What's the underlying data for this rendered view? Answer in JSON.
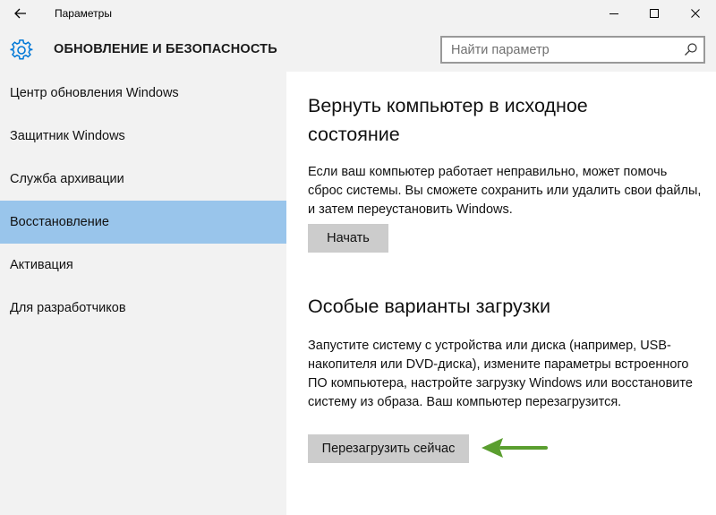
{
  "window": {
    "title": "Параметры"
  },
  "header": {
    "section_title": "ОБНОВЛЕНИЕ И БЕЗОПАСНОСТЬ",
    "search_placeholder": "Найти параметр",
    "search_value": ""
  },
  "sidebar": {
    "items": [
      {
        "label": "Центр обновления Windows",
        "active": false
      },
      {
        "label": "Защитник Windows",
        "active": false
      },
      {
        "label": "Служба архивации",
        "active": false
      },
      {
        "label": "Восстановление",
        "active": true
      },
      {
        "label": "Активация",
        "active": false
      },
      {
        "label": "Для разработчиков",
        "active": false
      }
    ]
  },
  "reset": {
    "title_line1": "Вернуть компьютер в исходное",
    "title_line2": "состояние",
    "description": "Если ваш компьютер работает неправильно, может помочь сброс системы. Вы сможете сохранить или удалить свои файлы, и затем переустановить Windows.",
    "button_label": "Начать"
  },
  "advanced": {
    "title": "Особые варианты загрузки",
    "description": "Запустите систему с устройства или диска (например, USB-накопителя или DVD-диска), измените параметры встроенного ПО компьютера, настройте загрузку Windows или восстановите систему из образа. Ваш компьютер перезагрузится.",
    "button_label": "Перезагрузить сейчас"
  },
  "colors": {
    "chrome_bg": "#f2f2f2",
    "active_item": "#99c5eb",
    "accent": "#0078d7",
    "button_bg": "#cccccc",
    "annotation_arrow": "#5a9e2f"
  },
  "icons": {
    "back": "arrow-left-icon",
    "settings": "gear-icon",
    "search": "search-icon",
    "minimize": "minimize-icon",
    "maximize": "maximize-icon",
    "close": "close-icon",
    "annotation": "arrow-left-annotation"
  }
}
